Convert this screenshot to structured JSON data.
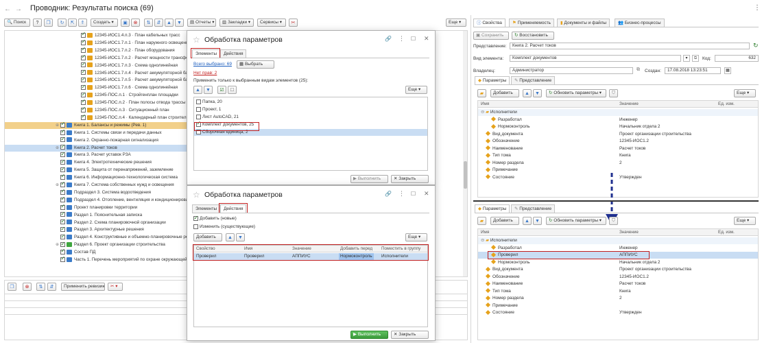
{
  "window": {
    "title": "Проводник: Результаты поиска (69)",
    "menu_dots": "⋮"
  },
  "left_toolbar": {
    "search": "Поиск",
    "help": "?",
    "create": "Создать",
    "reports": "Отчеты",
    "bookmarks": "Закладки",
    "services": "Сервисы",
    "more": "Еще"
  },
  "tree": [
    {
      "text": "12345-ИОС1.4.п.3 · План кабельных трасс",
      "icon": "doc",
      "indent": 1
    },
    {
      "text": "12345-ИОС1.7.п.1 · План наружного освещения",
      "icon": "doc",
      "indent": 1
    },
    {
      "text": "12345-ИОС1.7.п.2 · План оборудования",
      "icon": "doc",
      "indent": 1
    },
    {
      "text": "12345-ИОС1.7.п.2 · Расчет мощности трансформатора",
      "icon": "doc",
      "indent": 1
    },
    {
      "text": "12345-ИОС1.7.п.3 · Схема однолинейная",
      "icon": "doc",
      "indent": 1
    },
    {
      "text": "12345-ИОС1.7.п.4 · Расчет аккумуляторной батареи",
      "icon": "doc",
      "indent": 1
    },
    {
      "text": "12345-ИОС1.7.п.5 · Расчет аккумуляторной батареи",
      "icon": "doc",
      "indent": 1
    },
    {
      "text": "12345-ИОС1.7.п.6 · Схема однолинейная",
      "icon": "doc",
      "indent": 1
    },
    {
      "text": "12345-ПОС.п.1 · Стройгенплан площадки",
      "icon": "doc",
      "indent": 1
    },
    {
      "text": "12345-ПОС.п.2 · План полосы отвода трассы",
      "icon": "doc",
      "indent": 1
    },
    {
      "text": "12345-ПОС.п.3 · Ситуационный план",
      "icon": "doc",
      "indent": 1
    },
    {
      "text": "12345-ПОС.п.4 · Календарный план строительства",
      "icon": "doc",
      "indent": 1
    },
    {
      "text": "Книга 1. Балансы и режимы (Рев. 1)",
      "icon": "book",
      "indent": 0,
      "exp": "⊕",
      "sel": "yellow"
    },
    {
      "text": "Книга 1. Системы связи и передачи данных",
      "icon": "book",
      "indent": 0
    },
    {
      "text": "Книга 2. Охранно-пожарная сигнализация",
      "icon": "book",
      "indent": 0
    },
    {
      "text": "Книга 2. Расчет токов",
      "icon": "book",
      "indent": 0,
      "exp": "⊕",
      "sel": "blue"
    },
    {
      "text": "Книга 3. Расчет уставок РЗА",
      "icon": "book",
      "indent": 0
    },
    {
      "text": "Книга 4. Электротехнические решения",
      "icon": "book",
      "indent": 0
    },
    {
      "text": "Книга 5. Защита от перенапряжений, заземление",
      "icon": "book",
      "indent": 0
    },
    {
      "text": "Книга 6. Информационно-технологическая система",
      "icon": "book",
      "indent": 0
    },
    {
      "text": "Книга 7. Система собственных нужд и освещения",
      "icon": "book",
      "indent": 0,
      "exp": "⊕"
    },
    {
      "text": "Подраздел 3. Система водоотведения",
      "icon": "book",
      "indent": 0
    },
    {
      "text": "Подраздел 4. Отопление, вентиляция и кондиционирование",
      "icon": "book",
      "indent": 0
    },
    {
      "text": "Проект планировки территории",
      "icon": "book",
      "indent": 0
    },
    {
      "text": "Раздел 1. Пояснительная записка",
      "icon": "book",
      "indent": 0
    },
    {
      "text": "Раздел 2. Схема планировочной организации",
      "icon": "book",
      "indent": 0
    },
    {
      "text": "Раздел 3. Архитектурные решения",
      "icon": "book",
      "indent": 0
    },
    {
      "text": "Раздел 4. Конструктивные и объемно-планировочные решения",
      "icon": "book",
      "indent": 0
    },
    {
      "text": "Раздел 6. Проект организации строительства",
      "icon": "grn",
      "indent": 0,
      "exp": "⊕"
    },
    {
      "text": "Состав ПД",
      "icon": "book",
      "indent": 0
    },
    {
      "text": "Часть 1. Перечень мероприятий по охране окружающей среды",
      "icon": "book",
      "indent": 0
    }
  ],
  "bottom_toolbar": {
    "apply_revision": "Применить ревизию"
  },
  "dialog1": {
    "title": "Обработка параметров",
    "tab_elements": "Элементы",
    "tab_actions": "Действия",
    "selected_total": "Всего выбрано: 69",
    "select_btn": "Выбрать",
    "no_rights": "Нет прав: 2",
    "apply_only": "Применить только к выбранным видам элементов (25):",
    "more": "Еще",
    "list": [
      {
        "label": "Папка, 20",
        "checked": false
      },
      {
        "label": "Проект, 1",
        "checked": false
      },
      {
        "label": "Лист AutoCAD, 21",
        "checked": false
      },
      {
        "label": "Комплект документов, 25",
        "checked": true
      },
      {
        "label": "Сборочная единица, 2",
        "checked": false
      }
    ],
    "execute": "Выполнить",
    "close": "Закрыть"
  },
  "dialog2": {
    "title": "Обработка параметров",
    "tab_elements": "Элементы",
    "tab_actions": "Действия",
    "add_new": "Добавить (новые)",
    "change_existing": "Изменить (существующие)",
    "add_btn": "Добавить",
    "more": "Еще",
    "columns": [
      "Свойство",
      "Имя",
      "Значение",
      "Добавить перед",
      "Поместить в группу"
    ],
    "row": [
      "Проверил",
      "Проверил",
      "АППИУС",
      "Нормоконтроль",
      "Исполнители"
    ],
    "execute": "Выполнить",
    "close": "Закрыть"
  },
  "right_tabs": {
    "properties": "Свойства",
    "applicability": "Применяемость",
    "docs_files": "Документы и файлы",
    "business": "Бизнес-процессы"
  },
  "right_form": {
    "save": "Сохранить",
    "restore": "Восстановить",
    "repr_label": "Представление:",
    "repr_value": "Книга 2. Расчет токов",
    "kind_label": "Вид элемента:",
    "kind_value": "Комплект документов",
    "code_label": "Код:",
    "code_value": "632",
    "owner_label": "Владелец:",
    "owner_value": "Администратор",
    "created_label": "Создан:",
    "created_value": "17.08.2018 13:23:51"
  },
  "params_top": {
    "tab_params": "Параметры",
    "tab_repr": "Представление",
    "add": "Добавить",
    "refresh": "Обновить параметры",
    "more": "Еще",
    "col_name": "Имя",
    "col_value": "Значение",
    "col_unit": "Ед. изм.",
    "rows": [
      {
        "name": "Исполнители",
        "value": "",
        "group": true
      },
      {
        "name": "Разработал",
        "value": "Инженер",
        "level": 2
      },
      {
        "name": "Нормоконтроль",
        "value": "Начальник отдела 2",
        "level": 2
      },
      {
        "name": "Вид документа",
        "value": "Проект организации строительства",
        "level": 1
      },
      {
        "name": "Обозначение",
        "value": "12345-ИОС1.2",
        "level": 1
      },
      {
        "name": "Наименование",
        "value": "Расчет токов",
        "level": 1
      },
      {
        "name": "Тип тома",
        "value": "Книга",
        "level": 1
      },
      {
        "name": "Номер раздела",
        "value": "2",
        "level": 1
      },
      {
        "name": "Примечание",
        "value": "",
        "level": 1
      },
      {
        "name": "Состояние",
        "value": "Утвержден",
        "level": 1
      }
    ]
  },
  "params_bottom": {
    "tab_params": "Параметры",
    "tab_repr": "Представление",
    "add": "Добавить",
    "refresh": "Обновить параметры",
    "more": "Еще",
    "col_name": "Имя",
    "col_value": "Значение",
    "col_unit": "Ед. изм.",
    "rows": [
      {
        "name": "Исполнители",
        "value": "",
        "group": true
      },
      {
        "name": "Разработал",
        "value": "Инженер",
        "level": 2
      },
      {
        "name": "Проверил",
        "value": "АППИУС",
        "level": 2,
        "hl": true
      },
      {
        "name": "Нормоконтроль",
        "value": "Начальник отдела 2",
        "level": 2
      },
      {
        "name": "Вид документа",
        "value": "Проект организации строительства",
        "level": 1
      },
      {
        "name": "Обозначение",
        "value": "12345-ИОС1.2",
        "level": 1
      },
      {
        "name": "Наименование",
        "value": "Расчет токов",
        "level": 1
      },
      {
        "name": "Тип тома",
        "value": "Книга",
        "level": 1
      },
      {
        "name": "Номер раздела",
        "value": "2",
        "level": 1
      },
      {
        "name": "Примечание",
        "value": "",
        "level": 1
      },
      {
        "name": "Состояние",
        "value": "Утвержден",
        "level": 1
      }
    ]
  },
  "colors": {
    "accent_blue": "#1d5fbf",
    "highlight_red": "#c21f1f",
    "row_select_yellow": "#f2d08a",
    "row_select_blue": "#c9ddf3",
    "arrow": "#1f2f8f"
  }
}
